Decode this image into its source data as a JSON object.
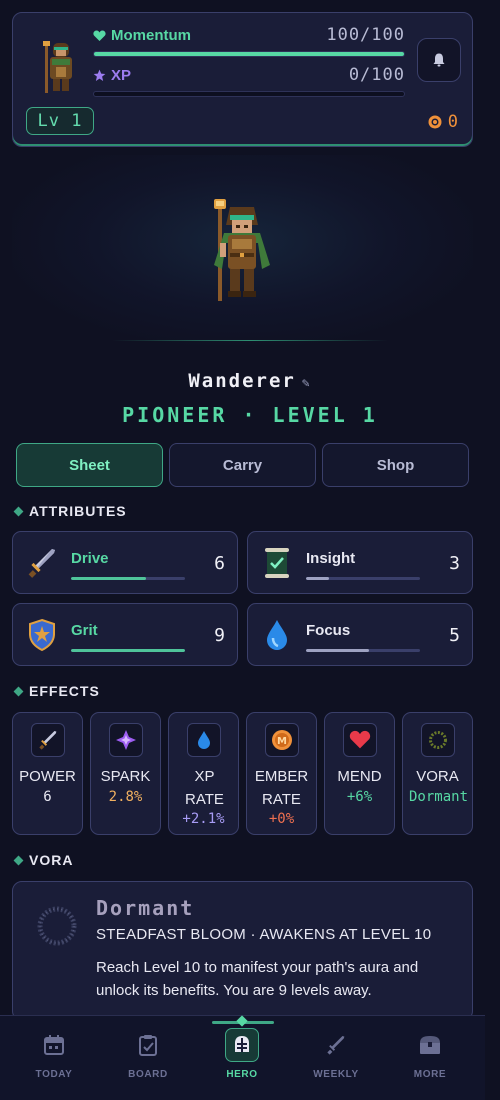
{
  "colors": {
    "accent": "#57d8a4",
    "xp": "#9c7cf0",
    "coin": "#f0913a",
    "background": "#0f1122",
    "card": "#1a1d38"
  },
  "header": {
    "momentum_label": "Momentum",
    "momentum_value": "100/100",
    "momentum_progress": 1.0,
    "xp_label": "XP",
    "xp_value": "0/100",
    "xp_progress": 0.0,
    "level_badge": "Lv 1",
    "coins": "0",
    "icons": [
      "heart-icon",
      "star-icon",
      "bell-icon",
      "coin-icon"
    ]
  },
  "hero": {
    "name": "Wanderer",
    "class_level": "PIONEER · LEVEL 1"
  },
  "tabs": [
    {
      "label": "Sheet",
      "active": true
    },
    {
      "label": "Carry",
      "active": false
    },
    {
      "label": "Shop",
      "active": false
    }
  ],
  "attributes": {
    "title": "ATTRIBUTES",
    "items": [
      {
        "name": "Drive",
        "value": "6",
        "icon": "sword-icon",
        "name_color": "#57d8a4",
        "fill_color": "#4fc49a",
        "progress": 0.66
      },
      {
        "name": "Insight",
        "value": "3",
        "icon": "scroll-icon",
        "name_color": "#e8e8f2",
        "fill_color": "#9ea2c2",
        "progress": 0.2
      },
      {
        "name": "Grit",
        "value": "9",
        "icon": "shield-icon",
        "name_color": "#57d8a4",
        "fill_color": "#4fc49a",
        "progress": 1.0
      },
      {
        "name": "Focus",
        "value": "5",
        "icon": "droplet-icon",
        "name_color": "#e8e8f2",
        "fill_color": "#9ea2c2",
        "progress": 0.55
      }
    ]
  },
  "effects": {
    "title": "EFFECTS",
    "items": [
      {
        "label": "POWER",
        "value": "6",
        "icon": "sword-icon",
        "color": "#e8e8f2"
      },
      {
        "label": "SPARK",
        "value": "2.8%",
        "icon": "spark-icon",
        "color": "#f0b060"
      },
      {
        "label": "XP RATE",
        "value": "+2.1%",
        "icon": "droplet-icon",
        "color": "#a89cf5"
      },
      {
        "label": "EMBER RATE",
        "value": "+0%",
        "icon": "coin-icon",
        "color": "#f07050"
      },
      {
        "label": "MEND",
        "value": "+6%",
        "icon": "heart-icon",
        "color": "#57d8a4"
      },
      {
        "label": "VORA",
        "value": "Dormant",
        "icon": "ring-icon",
        "color": "#57d8a4"
      }
    ]
  },
  "vora": {
    "title": "VORA",
    "status": "Dormant",
    "subtitle": "STEADFAST BLOOM · AWAKENS AT LEVEL 10",
    "description": "Reach Level 10 to manifest your path's aura and unlock its benefits. You are 9 levels away."
  },
  "nav": [
    {
      "label": "TODAY",
      "icon": "calendar-icon",
      "active": false
    },
    {
      "label": "BOARD",
      "icon": "clipboard-icon",
      "active": false
    },
    {
      "label": "HERO",
      "icon": "helmet-icon",
      "active": true
    },
    {
      "label": "WEEKLY",
      "icon": "sword-icon",
      "active": false
    },
    {
      "label": "MORE",
      "icon": "chest-icon",
      "active": false
    }
  ]
}
